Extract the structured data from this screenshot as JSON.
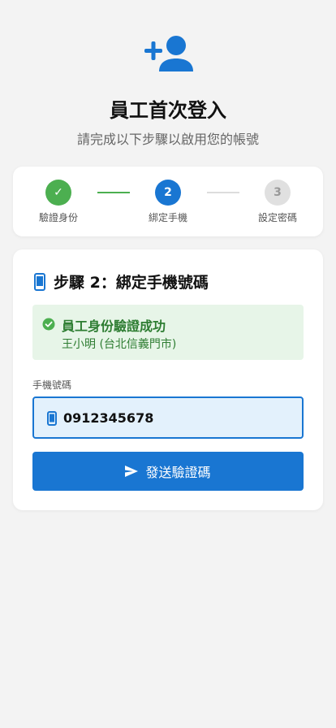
{
  "header": {
    "icon": "person-add-icon",
    "title": "員工首次登入",
    "subtitle": "請完成以下步驟以啟用您的帳號"
  },
  "stepper": {
    "steps": [
      {
        "number": "✓",
        "label": "驗證身份",
        "status": "completed"
      },
      {
        "number": "2",
        "label": "綁定手機",
        "status": "active"
      },
      {
        "number": "3",
        "label": "設定密碼",
        "status": "pending"
      }
    ]
  },
  "card": {
    "title_icon": "smartphone-icon",
    "title": "步驟 2：綁定手機號碼",
    "success": {
      "icon": "check-circle-icon",
      "title": "員工身份驗證成功",
      "detail": "王小明 (台北信義門市)"
    },
    "phone_field": {
      "label": "手機號碼",
      "icon": "smartphone-icon",
      "value": "0912345678",
      "placeholder": ""
    },
    "send_button": {
      "icon": "send-icon",
      "label": "發送驗證碼"
    }
  },
  "colors": {
    "primary": "#1976d2",
    "success": "#4caf50",
    "success_text": "#2e7d32",
    "success_bg": "#e7f5e8",
    "pending": "#e0e0e0",
    "background": "#f3f3f3"
  }
}
